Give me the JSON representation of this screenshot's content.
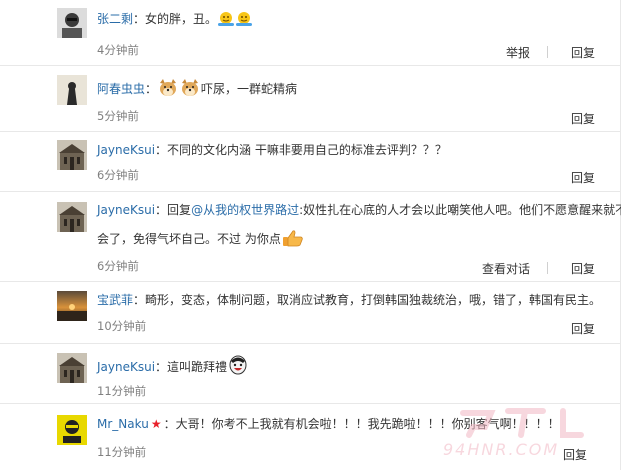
{
  "colors": {
    "username": "#2a6ca8",
    "time": "#808080",
    "verified_star": "#e8202a"
  },
  "comments": [
    {
      "user": "张二剩",
      "text_pre": "：女的胖，丑。",
      "emojis": [
        "shrug-icon",
        "shrug-icon"
      ],
      "time": "4分钟前",
      "report_label": "举报",
      "reply_label": "回复"
    },
    {
      "user": "阿春虫虫",
      "text_pre": "：",
      "emojis": [
        "doge-icon",
        "doge-icon"
      ],
      "text_post": "吓尿，一群蛇精病",
      "time": "5分钟前",
      "reply_label": "回复"
    },
    {
      "user": "JayneKsui",
      "text_pre": "：不同的文化内涵 干嘛非要用自己的标准去评判？？？",
      "time": "6分钟前",
      "reply_label": "回复"
    },
    {
      "user": "JayneKsui",
      "text_pre": "：回复",
      "mention": "@从我的权世界路过",
      "text_post": ":奴性扎在心底的人才会以此嘲笑他人吧。他们不愿意醒来就不",
      "text_line2": "会了，免得气坏自己。不过 为你点",
      "time": "6分钟前",
      "view_dialog_label": "查看对话",
      "reply_label": "回复"
    },
    {
      "user": "宝武菲",
      "text_pre": "：畸形，变态，体制问题，取消应试教育，打倒韩国独裁统治，哦，错了，韩国有民主。",
      "time": "10分钟前",
      "reply_label": "回复"
    },
    {
      "user": "JayneKsui",
      "text_pre": "：這叫跪拜禮",
      "time": "11分钟前",
      "reply_label": "回复"
    },
    {
      "user": "Mr_Naku",
      "text_pre": "：大哥！你考不上我就有机会啦！！！我先跪啦！！！你别客气啊！！！！",
      "time": "11分钟前",
      "reply_label": "回复"
    }
  ],
  "watermark": {
    "text": "94HNR.COM"
  }
}
